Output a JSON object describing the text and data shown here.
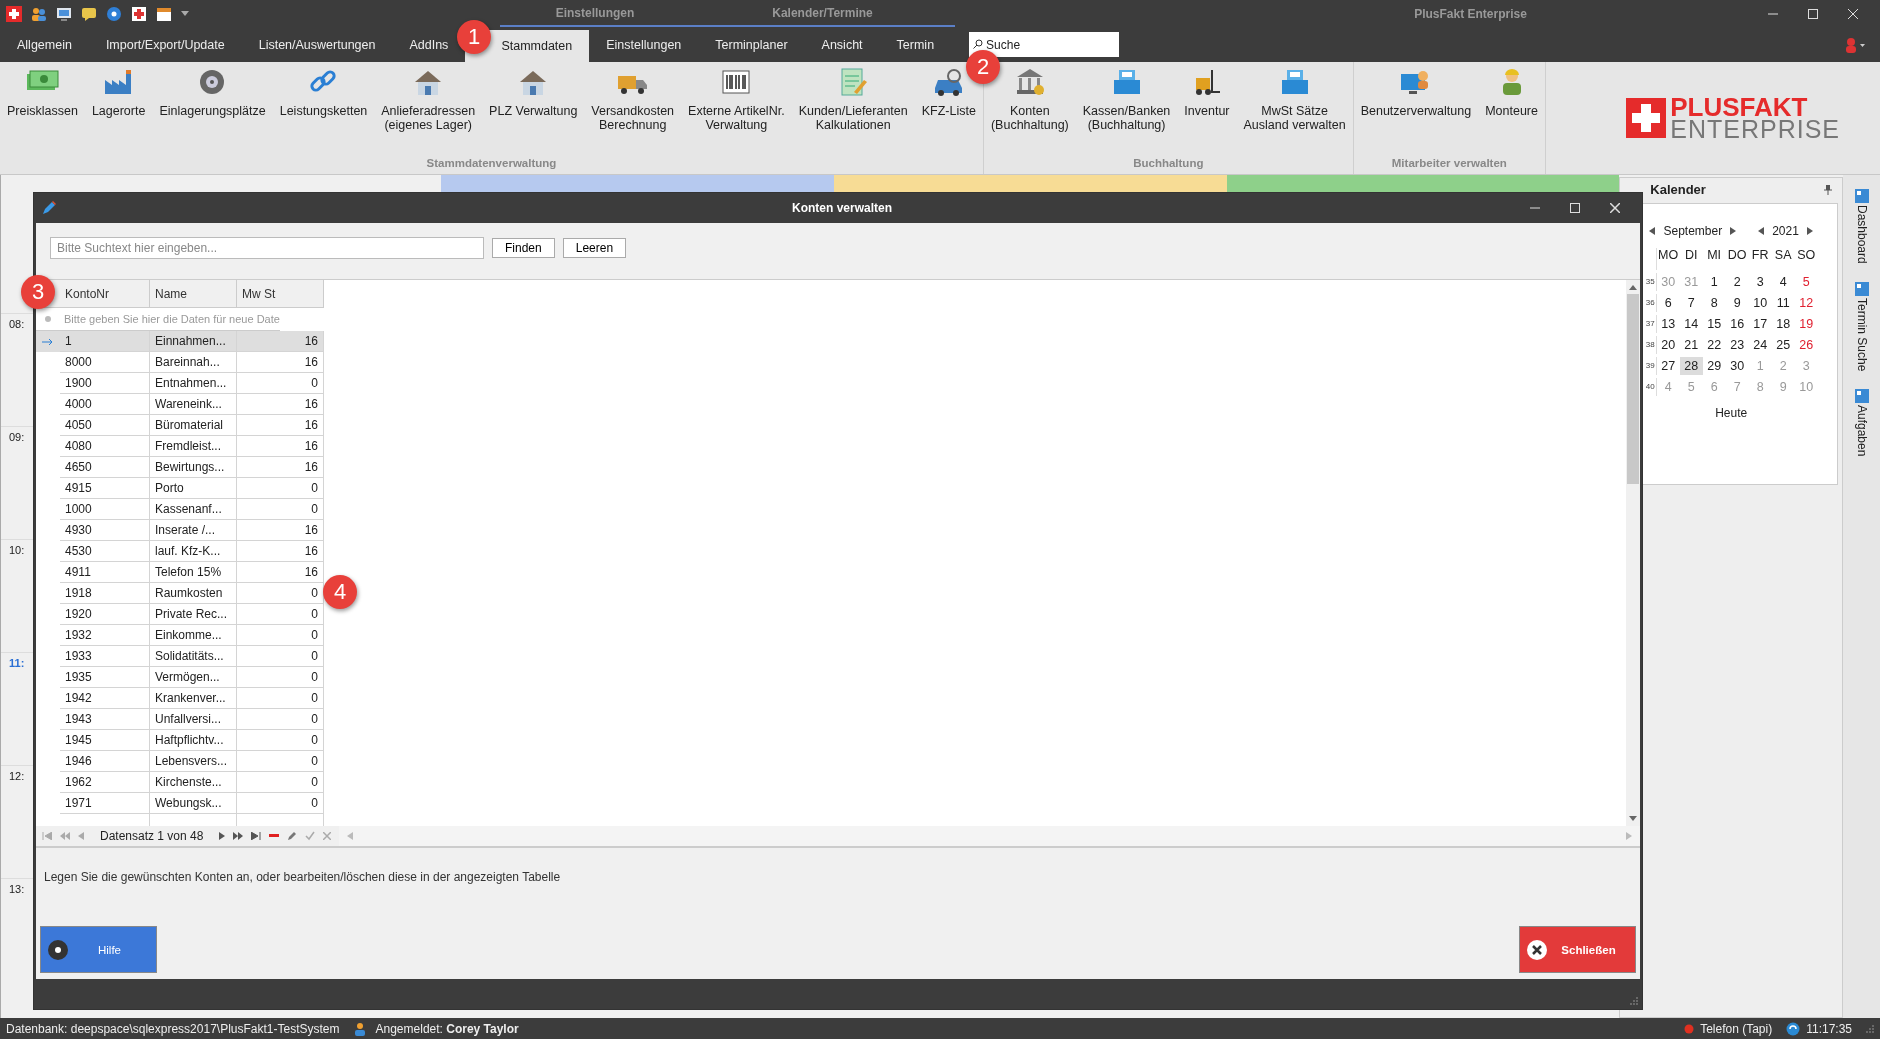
{
  "window": {
    "title": "PlusFakt Enterprise",
    "context_groups": [
      {
        "label": "Einstellungen",
        "color": "#5b7fc7"
      },
      {
        "label": "Kalender/Termine",
        "color": "#5b7fc7"
      }
    ]
  },
  "tabs": [
    {
      "label": "Allgemein",
      "selected": false
    },
    {
      "label": "Import/Export/Update",
      "selected": false
    },
    {
      "label": "Listen/Auswertungen",
      "selected": false
    },
    {
      "label": "AddIns",
      "selected": false
    },
    {
      "label": "Stammdaten",
      "selected": true
    },
    {
      "label": "Einstellungen",
      "selected": false
    },
    {
      "label": "Terminplaner",
      "selected": false
    },
    {
      "label": "Ansicht",
      "selected": false
    },
    {
      "label": "Termin",
      "selected": false
    }
  ],
  "search": {
    "placeholder": "Suche"
  },
  "ribbon_groups": [
    {
      "label": "Stammdatenverwaltung",
      "items": [
        {
          "label": "Preisklassen",
          "kind": "cash"
        },
        {
          "label": "Lagerorte",
          "kind": "factory"
        },
        {
          "label": "Einlagerungsplätze",
          "kind": "wheel"
        },
        {
          "label": "Leistungsketten",
          "kind": "chain"
        },
        {
          "label": "Anlieferadressen\n(eigenes Lager)",
          "kind": "house"
        },
        {
          "label": "PLZ Verwaltung",
          "kind": "house"
        },
        {
          "label": "Versandkosten\nBerechnung",
          "kind": "truck"
        },
        {
          "label": "Externe ArtikelNr.\nVerwaltung",
          "kind": "barcode"
        },
        {
          "label": "Kunden/Lieferanten\nKalkulationen",
          "kind": "document"
        },
        {
          "label": "KFZ-Liste",
          "kind": "car"
        }
      ]
    },
    {
      "label": "Buchhaltung",
      "items": [
        {
          "label": "Konten\n(Buchhaltung)",
          "kind": "bank"
        },
        {
          "label": "Kassen/Banken\n(Buchhaltung)",
          "kind": "register"
        },
        {
          "label": "Inventur",
          "kind": "forklift"
        },
        {
          "label": "MwSt Sätze\nAusland verwalten",
          "kind": "register"
        }
      ]
    },
    {
      "label": "Mitarbeiter verwalten",
      "items": [
        {
          "label": "Benutzerverwaltung",
          "kind": "monitor"
        },
        {
          "label": "Monteure",
          "kind": "person"
        }
      ]
    }
  ],
  "logo": {
    "line1": "PLUSFAKT",
    "line2": "ENTERPRISE"
  },
  "hours": [
    {
      "label": "08:",
      "current": false
    },
    {
      "label": "09:",
      "current": false
    },
    {
      "label": "10:",
      "current": false
    },
    {
      "label": "11:",
      "current": true
    },
    {
      "label": "12:",
      "current": false
    },
    {
      "label": "13:",
      "current": false
    }
  ],
  "dialog": {
    "title": "Konten verwalten",
    "search_placeholder": "Bitte Suchtext hier eingeben...",
    "find_button": "Finden",
    "clear_button": "Leeren",
    "columns": [
      "KontoNr",
      "Name",
      "Mw St"
    ],
    "new_row_hint": "Bitte geben Sie hier die Daten für neue Date",
    "rows": [
      {
        "konto": "1",
        "name": "Einnahmen...",
        "mwst": "16",
        "selected": true
      },
      {
        "konto": "8000",
        "name": "Bareinnah...",
        "mwst": "16",
        "selected": false
      },
      {
        "konto": "1900",
        "name": "Entnahmen...",
        "mwst": "0",
        "selected": false
      },
      {
        "konto": "4000",
        "name": "Wareneink...",
        "mwst": "16",
        "selected": false
      },
      {
        "konto": "4050",
        "name": "Büromaterial",
        "mwst": "16",
        "selected": false
      },
      {
        "konto": "4080",
        "name": "Fremdleist...",
        "mwst": "16",
        "selected": false
      },
      {
        "konto": "4650",
        "name": "Bewirtungs...",
        "mwst": "16",
        "selected": false
      },
      {
        "konto": "4915",
        "name": "Porto",
        "mwst": "0",
        "selected": false
      },
      {
        "konto": "1000",
        "name": "Kassenanf...",
        "mwst": "0",
        "selected": false
      },
      {
        "konto": "4930",
        "name": "Inserate /...",
        "mwst": "16",
        "selected": false
      },
      {
        "konto": "4530",
        "name": "lauf. Kfz-K...",
        "mwst": "16",
        "selected": false
      },
      {
        "konto": "4911",
        "name": "Telefon 15%",
        "mwst": "16",
        "selected": false
      },
      {
        "konto": "1918",
        "name": "Raumkosten",
        "mwst": "0",
        "selected": false
      },
      {
        "konto": "1920",
        "name": "Private Rec...",
        "mwst": "0",
        "selected": false
      },
      {
        "konto": "1932",
        "name": "Einkomme...",
        "mwst": "0",
        "selected": false
      },
      {
        "konto": "1933",
        "name": "Solidatitäts...",
        "mwst": "0",
        "selected": false
      },
      {
        "konto": "1935",
        "name": "Vermögen...",
        "mwst": "0",
        "selected": false
      },
      {
        "konto": "1942",
        "name": "Krankenver...",
        "mwst": "0",
        "selected": false
      },
      {
        "konto": "1943",
        "name": "Unfallversi...",
        "mwst": "0",
        "selected": false
      },
      {
        "konto": "1945",
        "name": "Haftpflichtv...",
        "mwst": "0",
        "selected": false
      },
      {
        "konto": "1946",
        "name": "Lebensvers...",
        "mwst": "0",
        "selected": false
      },
      {
        "konto": "1962",
        "name": "Kirchenste...",
        "mwst": "0",
        "selected": false
      },
      {
        "konto": "1971",
        "name": "Webungsk...",
        "mwst": "0",
        "selected": false
      }
    ],
    "navigator": "Datensatz 1 von 48",
    "description": "Legen Sie die gewünschten Konten an, oder bearbeiten/löschen diese in der angezeigten Tabelle",
    "help_button": "Hilfe",
    "close_button": "Schließen"
  },
  "calendar": {
    "title": "Kalender",
    "month": "September",
    "year": "2021",
    "weekdays": [
      "MO",
      "DI",
      "MI",
      "DO",
      "FR",
      "SA",
      "SO"
    ],
    "weeks": [
      {
        "no": "35",
        "days": [
          {
            "d": "30",
            "kind": "other",
            "selected": false
          },
          {
            "d": "31",
            "kind": "other",
            "selected": false
          },
          {
            "d": "1",
            "kind": "weekday",
            "selected": false
          },
          {
            "d": "2",
            "kind": "weekday",
            "selected": false
          },
          {
            "d": "3",
            "kind": "weekday",
            "selected": false
          },
          {
            "d": "4",
            "kind": "weekday",
            "selected": false
          },
          {
            "d": "5",
            "kind": "sunday",
            "selected": false
          }
        ]
      },
      {
        "no": "36",
        "days": [
          {
            "d": "6",
            "kind": "weekday",
            "selected": false
          },
          {
            "d": "7",
            "kind": "weekday",
            "selected": false
          },
          {
            "d": "8",
            "kind": "weekday",
            "selected": false
          },
          {
            "d": "9",
            "kind": "weekday",
            "selected": false
          },
          {
            "d": "10",
            "kind": "weekday",
            "selected": false
          },
          {
            "d": "11",
            "kind": "weekday",
            "selected": false
          },
          {
            "d": "12",
            "kind": "sunday",
            "selected": false
          }
        ]
      },
      {
        "no": "37",
        "days": [
          {
            "d": "13",
            "kind": "weekday",
            "selected": false
          },
          {
            "d": "14",
            "kind": "weekday",
            "selected": false
          },
          {
            "d": "15",
            "kind": "weekday",
            "selected": false
          },
          {
            "d": "16",
            "kind": "weekday",
            "selected": false
          },
          {
            "d": "17",
            "kind": "weekday",
            "selected": false
          },
          {
            "d": "18",
            "kind": "weekday",
            "selected": false
          },
          {
            "d": "19",
            "kind": "sunday",
            "selected": false
          }
        ]
      },
      {
        "no": "38",
        "days": [
          {
            "d": "20",
            "kind": "weekday",
            "selected": false
          },
          {
            "d": "21",
            "kind": "weekday",
            "selected": false
          },
          {
            "d": "22",
            "kind": "weekday",
            "selected": false
          },
          {
            "d": "23",
            "kind": "weekday",
            "selected": false
          },
          {
            "d": "24",
            "kind": "weekday",
            "selected": false
          },
          {
            "d": "25",
            "kind": "weekday",
            "selected": false
          },
          {
            "d": "26",
            "kind": "sunday",
            "selected": false
          }
        ]
      },
      {
        "no": "39",
        "days": [
          {
            "d": "27",
            "kind": "weekday",
            "selected": false
          },
          {
            "d": "28",
            "kind": "weekday",
            "selected": true
          },
          {
            "d": "29",
            "kind": "weekday",
            "selected": false
          },
          {
            "d": "30",
            "kind": "weekday",
            "selected": false
          },
          {
            "d": "1",
            "kind": "other",
            "selected": false
          },
          {
            "d": "2",
            "kind": "other",
            "selected": false
          },
          {
            "d": "3",
            "kind": "other",
            "selected": false
          }
        ]
      },
      {
        "no": "40",
        "days": [
          {
            "d": "4",
            "kind": "other",
            "selected": false
          },
          {
            "d": "5",
            "kind": "other",
            "selected": false
          },
          {
            "d": "6",
            "kind": "other",
            "selected": false
          },
          {
            "d": "7",
            "kind": "other",
            "selected": false
          },
          {
            "d": "8",
            "kind": "other",
            "selected": false
          },
          {
            "d": "9",
            "kind": "other",
            "selected": false
          },
          {
            "d": "10",
            "kind": "other",
            "selected": false
          }
        ]
      }
    ],
    "today_button": "Heute"
  },
  "side_tabs": [
    "Dashboard",
    "Termin Suche",
    "Aufgaben"
  ],
  "callouts": [
    "1",
    "2",
    "3",
    "4"
  ],
  "status_bar": {
    "database": "Datenbank: deepspace\\sqlexpress2017\\PlusFakt1-TestSystem",
    "user": "Angemeldet: **Corey Taylor**",
    "phone": "Telefon (Tapi)",
    "time": "11:17:35"
  }
}
